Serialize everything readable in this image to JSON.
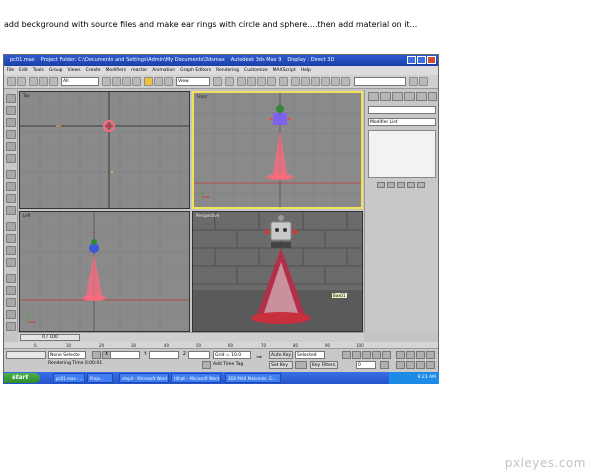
{
  "instruction": "add beckground with source files and make ear rings with circle and sphere....then add material on it...",
  "window": {
    "title_file": "pc01.max",
    "title_folder": "Project Folder: C:\\Documents and Settings\\Admin\\My Documents\\3dsmax",
    "title_app": "Autodesk 3ds Max 9",
    "title_display": "Display : Direct 3D"
  },
  "menu": [
    "File",
    "Edit",
    "Tools",
    "Group",
    "Views",
    "Create",
    "Modifiers",
    "reactor",
    "Animation",
    "Graph Editors",
    "Rendering",
    "Customize",
    "MAXScript",
    "Help"
  ],
  "toolbar": {
    "selection_filter": "All",
    "reference_coord": "View"
  },
  "viewports": {
    "top": "Top",
    "front": "Front",
    "left": "Left",
    "perspective": "Perspective"
  },
  "command_panel": {
    "modifier_list": "Modifier List"
  },
  "timeline": {
    "frame_range": "0 / 100",
    "ticks": [
      "0",
      "10",
      "20",
      "30",
      "40",
      "50",
      "60",
      "70",
      "80",
      "90",
      "100"
    ]
  },
  "status": {
    "selection": "None Selecte",
    "rendering_time": "Rendering Time 0:00:01",
    "x_label": "X",
    "y_label": "Y",
    "z_label": "Z",
    "grid": "Grid = 10.0",
    "add_time_tag": "Add Time Tag",
    "auto_key": "Auto Key",
    "set_key": "Set Key",
    "selected": "Selected",
    "key_filters": "Key Filters...",
    "frame": "0"
  },
  "tooltip": "Box01",
  "taskbar": {
    "start": "start",
    "tasks": [
      "pc01.max - ...",
      "Proje...",
      "step4 - Microsoft Word",
      "tithali - Microsoft Word",
      "3DS MAX Materials: Ci..."
    ],
    "clock": "9:23 AM"
  },
  "watermark": "pxleyes.com",
  "colors": {
    "titlebar": "#2f5bd0",
    "active_viewport": "#f2e25a",
    "mesh": "#ff6a7d",
    "taskbar": "#2553c9",
    "start": "#2e8a2e"
  }
}
